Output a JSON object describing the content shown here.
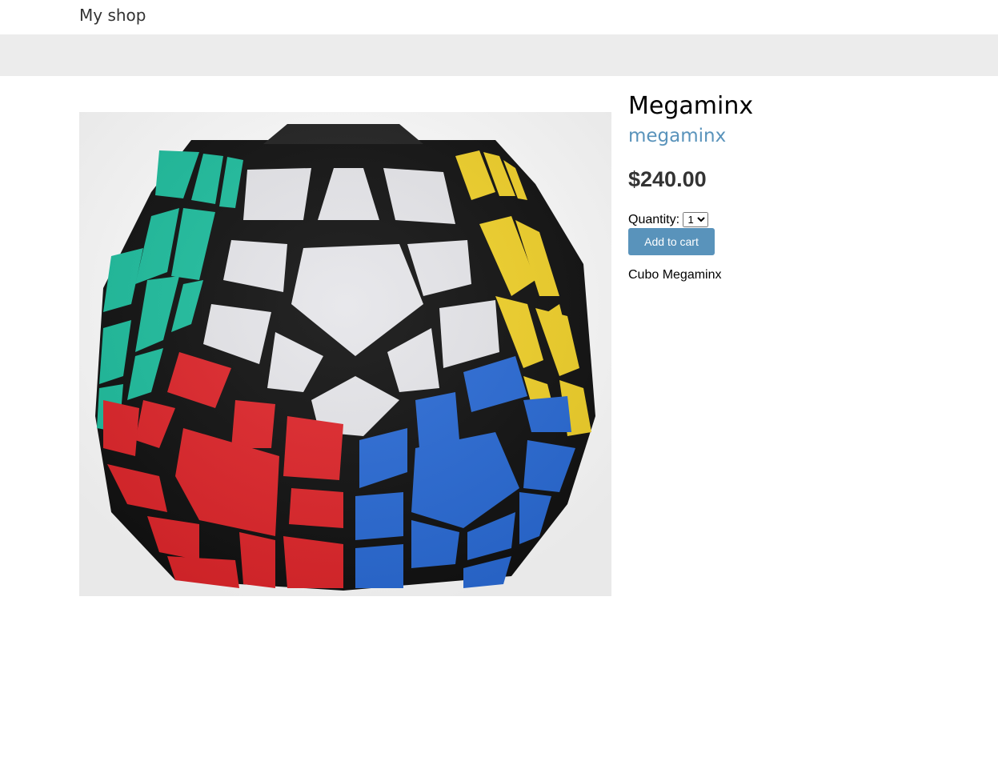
{
  "header": {
    "logo": "My shop"
  },
  "product": {
    "name": "Megaminx",
    "category": "megaminx",
    "price": "$240.00",
    "quantity_label": "Quantity:",
    "quantity_value": "1",
    "add_to_cart_label": "Add to cart",
    "description": "Cubo Megaminx"
  },
  "colors": {
    "accent": "#5993bb",
    "subheader_bg": "#ececec",
    "cube_green": "#1fbf9f",
    "cube_yellow": "#f2d22a",
    "cube_red": "#e0262b",
    "cube_blue": "#2a6bd6",
    "cube_white": "#e6e6ea"
  }
}
